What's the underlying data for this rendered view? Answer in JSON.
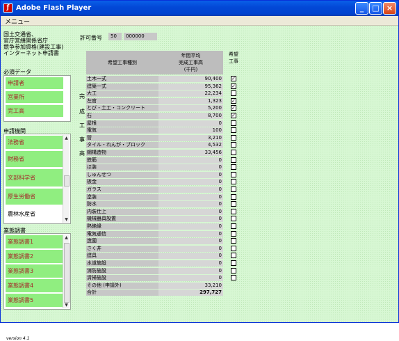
{
  "window": {
    "title": "Adobe Flash Player",
    "minimize": "_",
    "maximize": "□",
    "close": "×"
  },
  "menu": {
    "label": "メニュー"
  },
  "agency_lines": [
    "国土交通省、",
    "官庁営繕関係省庁",
    "競争参加資格(建設工事)",
    "インターネット申請書"
  ],
  "permit": {
    "label": "許可番号",
    "value1": "50",
    "value2": "000000"
  },
  "required": {
    "heading": "必須データ",
    "items": [
      "申請者",
      "営業所",
      "完工高"
    ]
  },
  "vertical_label": [
    "完",
    "成",
    "工",
    "事",
    "高"
  ],
  "agencies": {
    "heading": "申請機関",
    "items": [
      "法務省",
      "財務省",
      "文部科学省",
      "厚生労働省",
      "農林水産省"
    ]
  },
  "business": {
    "heading": "業態調書",
    "items": [
      "業態調書1",
      "業態調書2",
      "業態調書3",
      "業態調書4",
      "業態調書5"
    ]
  },
  "table": {
    "col_type": "希望工事種別",
    "col_amount": [
      "年間平均",
      "完成工事高",
      "(千円)"
    ],
    "col_wish": [
      "希望",
      "工事"
    ],
    "rows": [
      {
        "name": "土木一式",
        "value": "90,400",
        "checked": true
      },
      {
        "name": "建築一式",
        "value": "95,362",
        "checked": true
      },
      {
        "name": "大工",
        "value": "22,234",
        "checked": false
      },
      {
        "name": "左官",
        "value": "1,323",
        "checked": true
      },
      {
        "name": "とび・土工・コンクリート",
        "value": "5,200",
        "checked": true
      },
      {
        "name": "石",
        "value": "8,700",
        "checked": true
      },
      {
        "name": "屋根",
        "value": "0",
        "checked": false
      },
      {
        "name": "電気",
        "value": "100",
        "checked": false
      },
      {
        "name": "管",
        "value": "3,210",
        "checked": false
      },
      {
        "name": "タイル・れんが・ブロック",
        "value": "4,532",
        "checked": false
      },
      {
        "name": "鋼構造物",
        "value": "33,456",
        "checked": false
      },
      {
        "name": "鉄筋",
        "value": "0",
        "checked": false
      },
      {
        "name": "ほ装",
        "value": "0",
        "checked": false
      },
      {
        "name": "しゅんせつ",
        "value": "0",
        "checked": false
      },
      {
        "name": "板金",
        "value": "0",
        "checked": false
      },
      {
        "name": "ガラス",
        "value": "0",
        "checked": false
      },
      {
        "name": "塗装",
        "value": "0",
        "checked": false
      },
      {
        "name": "防水",
        "value": "0",
        "checked": false
      },
      {
        "name": "内装仕上",
        "value": "0",
        "checked": false
      },
      {
        "name": "機械器具設置",
        "value": "0",
        "checked": false
      },
      {
        "name": "熱絶縁",
        "value": "0",
        "checked": false
      },
      {
        "name": "電気通信",
        "value": "0",
        "checked": false
      },
      {
        "name": "造園",
        "value": "0",
        "checked": false
      },
      {
        "name": "さく井",
        "value": "0",
        "checked": false
      },
      {
        "name": "建具",
        "value": "0",
        "checked": false
      },
      {
        "name": "水道施設",
        "value": "0",
        "checked": false
      },
      {
        "name": "消防施設",
        "value": "0",
        "checked": false
      },
      {
        "name": "清掃施設",
        "value": "0",
        "checked": false
      }
    ],
    "other": {
      "name": "その他 (申請外)",
      "value": "33,210"
    },
    "total": {
      "name": "合計",
      "value": "297,727"
    }
  },
  "version": "version 4.1"
}
